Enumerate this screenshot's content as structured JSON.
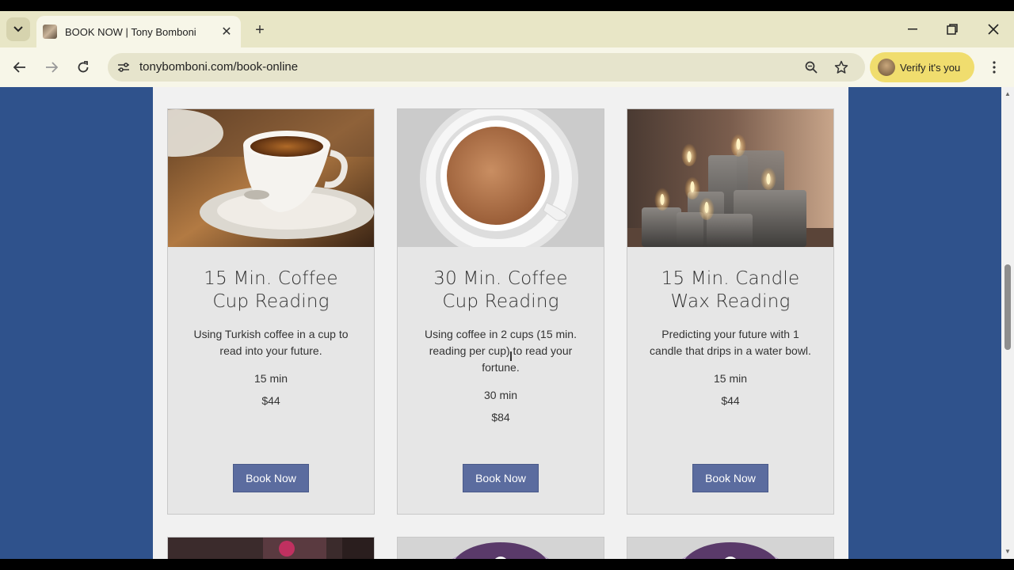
{
  "browser": {
    "tab_title": "BOOK NOW | Tony Bomboni",
    "url": "tonybomboni.com/book-online",
    "verify_label": "Verify it's you",
    "new_tab_label": "+",
    "close_tab_label": "✕"
  },
  "services": [
    {
      "title": "15 Min. Coffee Cup Reading",
      "description": "Using Turkish coffee in a cup to read into your future.",
      "duration": "15 min",
      "price": "$44",
      "button": "Book Now",
      "image": "coffee-cup-saucer-image"
    },
    {
      "title": "30 Min. Coffee Cup Reading",
      "description": "Using coffee in 2 cups (15 min. reading per cup) to read your fortune.",
      "duration": "30 min",
      "price": "$84",
      "button": "Book Now",
      "image": "coffee-cup-top-view-image"
    },
    {
      "title": "15 Min. Candle Wax Reading",
      "description": "Predicting your future with 1 candle that drips in a water bowl.",
      "duration": "15 min",
      "price": "$44",
      "button": "Book Now",
      "image": "candles-image"
    }
  ],
  "colors": {
    "page_bg": "#2f528c",
    "button_bg": "#5b6c9f",
    "verify_bg": "#f0dd6e"
  }
}
